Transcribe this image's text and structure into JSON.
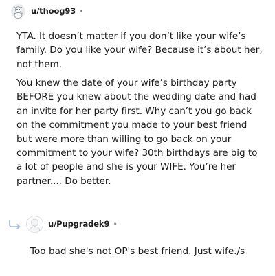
{
  "comment": {
    "author": "u/thoog93",
    "separator": "•",
    "avatar_icon": "snoo-avatar-icon",
    "paragraphs": [
      "YTA. It doesn’t matter if you don’t like your wife’s family. Do you like your wife? Because it’s about her, not them.",
      "You knew the date of your wife’s birthday party BEFORE you knew about the wedding date and had an invite for her party first. Why can’t you go back on the commitment you made to your best friend but were more than willing to go back on your commitment to your wife? 30th birthdays are big to a lot of people and she is your WIFE. You’re her partner.... Do better."
    ]
  },
  "reply": {
    "author": "u/Pupgradek9",
    "separator": "•",
    "reply_icon": "reply-arrow-icon",
    "avatar_icon": "default-avatar-icon",
    "text": "Too bad she's not OP's best friend. Just wife./s"
  },
  "colors": {
    "text": "#1c1c1c",
    "muted": "#878a8c",
    "reply_arrow": "#9fb8d8"
  }
}
